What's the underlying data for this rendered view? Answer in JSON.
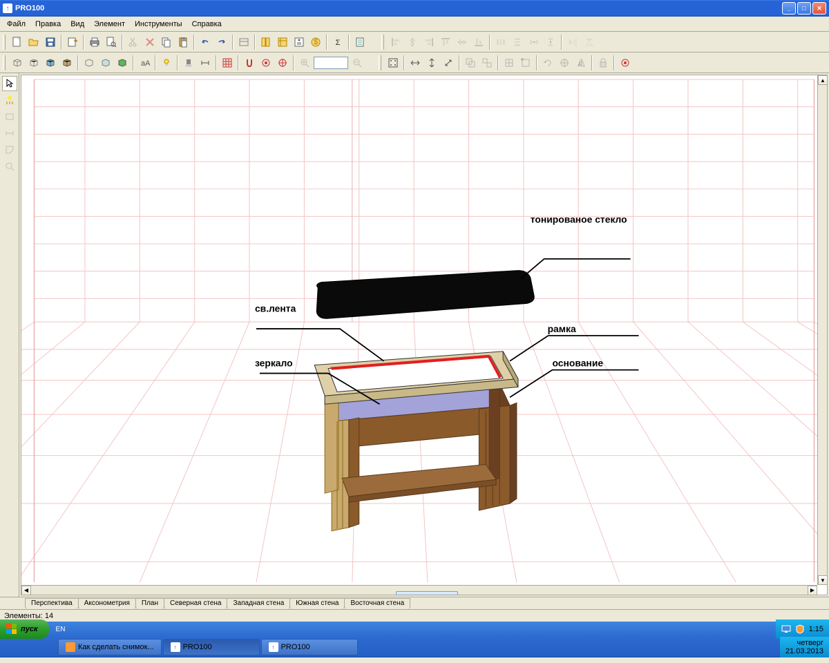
{
  "window": {
    "title": "PRO100"
  },
  "menu": [
    "Файл",
    "Правка",
    "Вид",
    "Элемент",
    "Инструменты",
    "Справка"
  ],
  "view_tabs": [
    "Перспектива",
    "Аксонометрия",
    "План",
    "Северная стена",
    "Западная стена",
    "Южная стена",
    "Восточная стена"
  ],
  "status": "Элементы: 14",
  "labels": {
    "glass": "тонированое стекло",
    "led": "св.лента",
    "mirror": "зеркало",
    "frame": "рамка",
    "base": "основание"
  },
  "taskbar": {
    "start": "пуск",
    "lang": "EN",
    "items": [
      {
        "label": "Как сделать снимок...",
        "icon_color": "#ff9933"
      },
      {
        "label": "PRO100",
        "icon_color": "#2663d6",
        "active": true
      },
      {
        "label": "PRO100",
        "icon_color": "#2663d6"
      }
    ],
    "time": "1:15",
    "day": "четверг",
    "date": "21.03.2013"
  }
}
